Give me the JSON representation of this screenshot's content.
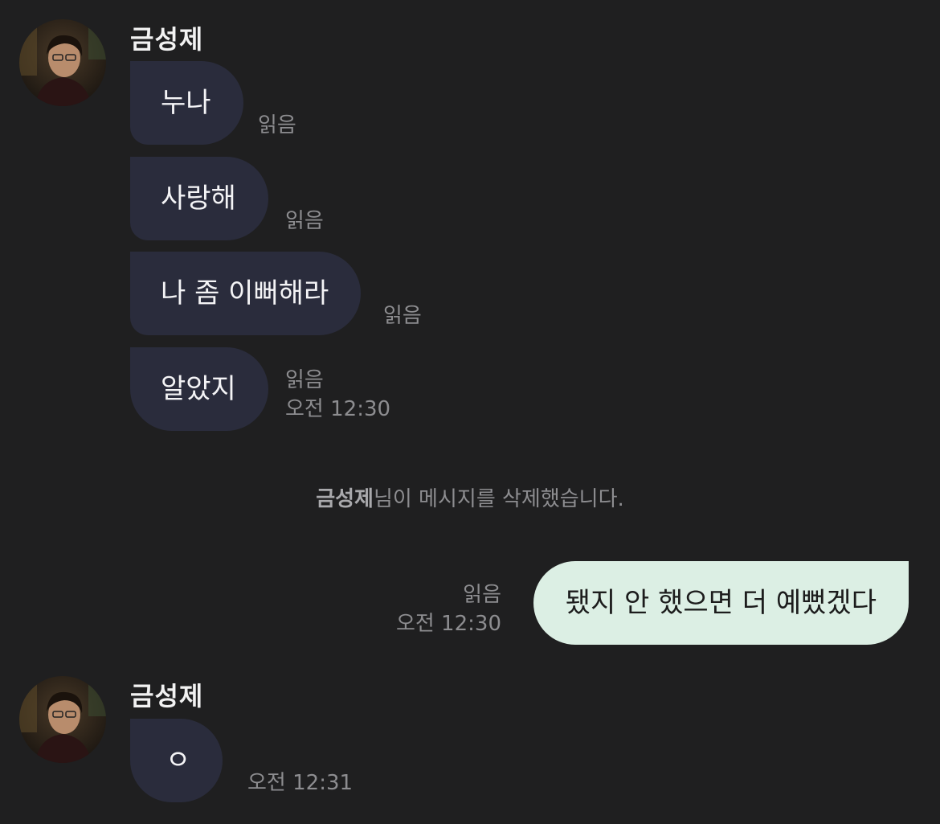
{
  "sender": {
    "name": "금성제"
  },
  "first_group": {
    "messages": [
      {
        "text": "누나",
        "read": "읽음"
      },
      {
        "text": "사랑해",
        "read": "읽음"
      },
      {
        "text": "나 좀 이뻐해라",
        "read": "읽음"
      },
      {
        "text": "알았지",
        "read": "읽음",
        "time": "오전 12:30"
      }
    ]
  },
  "system_notice": {
    "name": "금성제",
    "text": "님이 메시지를 삭제했습니다."
  },
  "outgoing": {
    "text": "됐지 안 했으면 더 예뻤겠다",
    "read": "읽음",
    "time": "오전 12:30"
  },
  "second_group": {
    "messages": [
      {
        "text": "ㅇ",
        "time": "오전 12:31"
      }
    ]
  },
  "colors": {
    "background": "#1f1f20",
    "incoming_bubble": "#2a2c3c",
    "outgoing_bubble": "#dcefe4",
    "meta_text": "#8d8d90"
  }
}
